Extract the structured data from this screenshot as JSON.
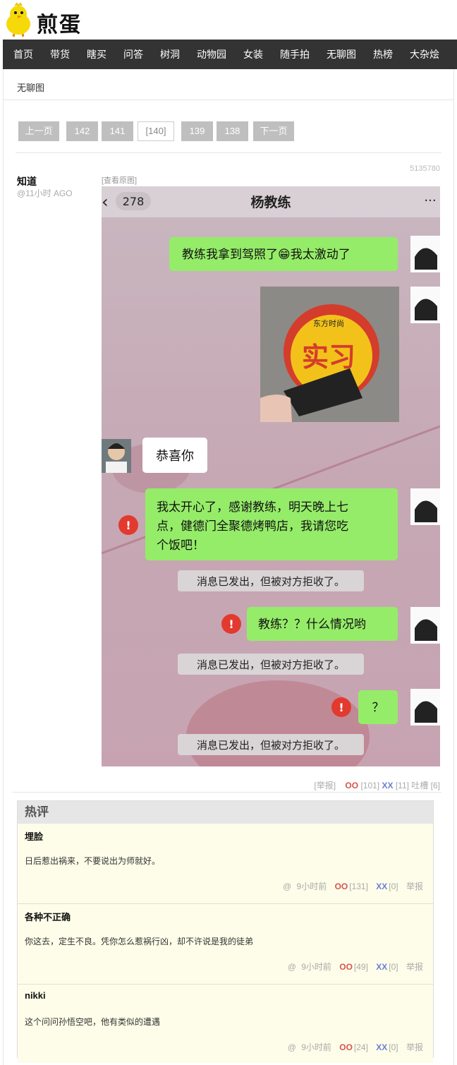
{
  "site": {
    "logo_text": "煎蛋"
  },
  "nav": [
    "首页",
    "带货",
    "瞎买",
    "问答",
    "树洞",
    "动物园",
    "女装",
    "随手拍",
    "无聊图",
    "热榜",
    "大杂烩"
  ],
  "breadcrumb": "无聊图",
  "pager": {
    "prev": "上一页",
    "pages": [
      "142",
      "141",
      "[140]",
      "139",
      "138"
    ],
    "next": "下一页"
  },
  "post": {
    "author": "知道",
    "ago": "@11小时 AGO",
    "id": "5135780",
    "view_original": "[查看原图]",
    "chat": {
      "back_count": "278",
      "contact": "杨教练",
      "more": "···",
      "msg1": "教练我拿到驾照了😁我太激动了",
      "sign_small": "东方时尚",
      "sign_big": "实习",
      "reply1": "恭喜你",
      "msg2_line1": "我太开心了，感谢教练，明天晚上七",
      "msg2_line2": "点，健德门全聚德烤鸭店，我请您吃",
      "msg2_line3": "个饭吧！",
      "rejected1": "消息已发出，但被对方拒收了。",
      "msg3": "教练？？什么情况哟",
      "rejected2": "消息已发出，但被对方拒收了。",
      "msg4": "？",
      "rejected3": "消息已发出，但被对方拒收了。",
      "alert_mark": "!"
    },
    "report": "[举报]",
    "oo_label": "OO",
    "oo_count": "[101]",
    "xx_label": "XX",
    "xx_count": "[11]",
    "tucao": "吐槽 [6]"
  },
  "hot": {
    "title": "热评",
    "comments": [
      {
        "author": "埋脸",
        "text": "日后惹出祸来，不要说出为师就好。",
        "at": "@",
        "time": "9小时前",
        "oo": "OO",
        "oo_count": "[131]",
        "xx": "XX",
        "xx_count": "[0]",
        "report": "举报"
      },
      {
        "author": "各种不正确",
        "text": "你这去，定生不良。凭你怎么惹祸行凶，却不许说是我的徒弟",
        "at": "@",
        "time": "9小时前",
        "oo": "OO",
        "oo_count": "[49]",
        "xx": "XX",
        "xx_count": "[0]",
        "report": "举报"
      },
      {
        "author": "nikki",
        "text": "这个问问孙悟空吧，他有类似的遭遇",
        "at": "@",
        "time": "9小时前",
        "oo": "OO",
        "oo_count": "[24]",
        "xx": "XX",
        "xx_count": "[0]",
        "report": "举报"
      }
    ]
  },
  "colors": {
    "nav_bg": "#333333",
    "oo": "#d9534f",
    "xx": "#6b7fd6",
    "wechat_green": "#95ec69",
    "comment_bg": "#fdfde9"
  }
}
